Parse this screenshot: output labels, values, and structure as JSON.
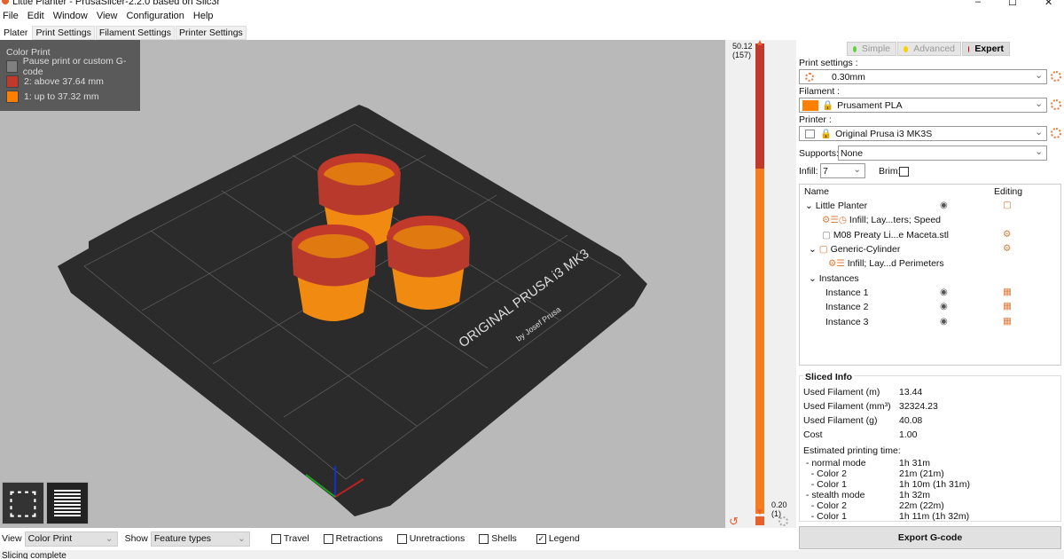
{
  "window": {
    "title": "Little Planter - PrusaSlicer-2.2.0 based on Slic3r",
    "minimize": "–",
    "maximize": "☐",
    "close": "✕"
  },
  "menu": [
    "File",
    "Edit",
    "Window",
    "View",
    "Configuration",
    "Help"
  ],
  "tabs": [
    "Plater",
    "Print Settings",
    "Filament Settings",
    "Printer Settings"
  ],
  "legend": {
    "title": "Color Print",
    "items": [
      {
        "label": "Pause print or custom G-code",
        "color": "#808080"
      },
      {
        "label": "2: above 37.64 mm",
        "color": "#c0392b"
      },
      {
        "label": "1: up to 37.32 mm",
        "color": "#ff8000"
      }
    ]
  },
  "slider": {
    "top_value": "50.12",
    "top_layer": "(157)",
    "bottom_value": "0.20",
    "bottom_layer": "(1)",
    "color_change_fraction": 0.27
  },
  "bed": {
    "brand": "ORIGINAL PRUSA i3 MK3",
    "sub": "by Josef Prusa"
  },
  "modes": {
    "simple": "Simple",
    "advanced": "Advanced",
    "expert": "Expert",
    "colors": {
      "simple": "#5ed13a",
      "advanced": "#f5d300",
      "expert": "#d00000"
    }
  },
  "sidebar": {
    "print_label": "Print settings :",
    "print_value": "0.30mm",
    "filament_label": "Filament :",
    "filament_value": "Prusament PLA",
    "filament_color": "#ff8000",
    "printer_label": "Printer :",
    "printer_value": "Original Prusa i3 MK3S",
    "supports_label": "Supports:",
    "supports_value": "None",
    "infill_label": "Infill:",
    "infill_value": "7",
    "brim_label": "Brim:"
  },
  "tree": {
    "col_name": "Name",
    "col_editing": "Editing",
    "rows": [
      {
        "label": "Little Planter"
      },
      {
        "label": "Infill; Lay...ters; Speed"
      },
      {
        "label": "M08 Preaty Li...e Maceta.stl"
      },
      {
        "label": "Generic-Cylinder"
      },
      {
        "label": "Infill; Lay...d Perimeters"
      },
      {
        "label": "Instances"
      },
      {
        "label": "Instance 1"
      },
      {
        "label": "Instance 2"
      },
      {
        "label": "Instance 3"
      }
    ]
  },
  "sliced": {
    "title": "Sliced Info",
    "rows": [
      {
        "k": "Used Filament (m)",
        "v": "13.44"
      },
      {
        "k": "Used Filament (mm³)",
        "v": "32324.23"
      },
      {
        "k": "Used Filament (g)",
        "v": "40.08"
      },
      {
        "k": "Cost",
        "v": "1.00"
      },
      {
        "k": "Estimated printing time:",
        "v": ""
      },
      {
        "k": " - normal mode",
        "v": "1h 31m"
      },
      {
        "k": "   - Color 2",
        "v": "21m (21m)"
      },
      {
        "k": "   - Color 1",
        "v": "1h 10m (1h 31m)"
      },
      {
        "k": " - stealth mode",
        "v": "1h 32m"
      },
      {
        "k": "   - Color 2",
        "v": "22m (22m)"
      },
      {
        "k": "   - Color 1",
        "v": "1h 11m (1h 32m)"
      }
    ]
  },
  "export_label": "Export G-code",
  "bottom": {
    "view_label": "View",
    "view_value": "Color Print",
    "show_label": "Show",
    "show_value": "Feature types",
    "checks": [
      {
        "label": "Travel",
        "checked": false
      },
      {
        "label": "Retractions",
        "checked": false
      },
      {
        "label": "Unretractions",
        "checked": false
      },
      {
        "label": "Shells",
        "checked": false
      },
      {
        "label": "Legend",
        "checked": true
      }
    ]
  },
  "status": "Slicing complete"
}
